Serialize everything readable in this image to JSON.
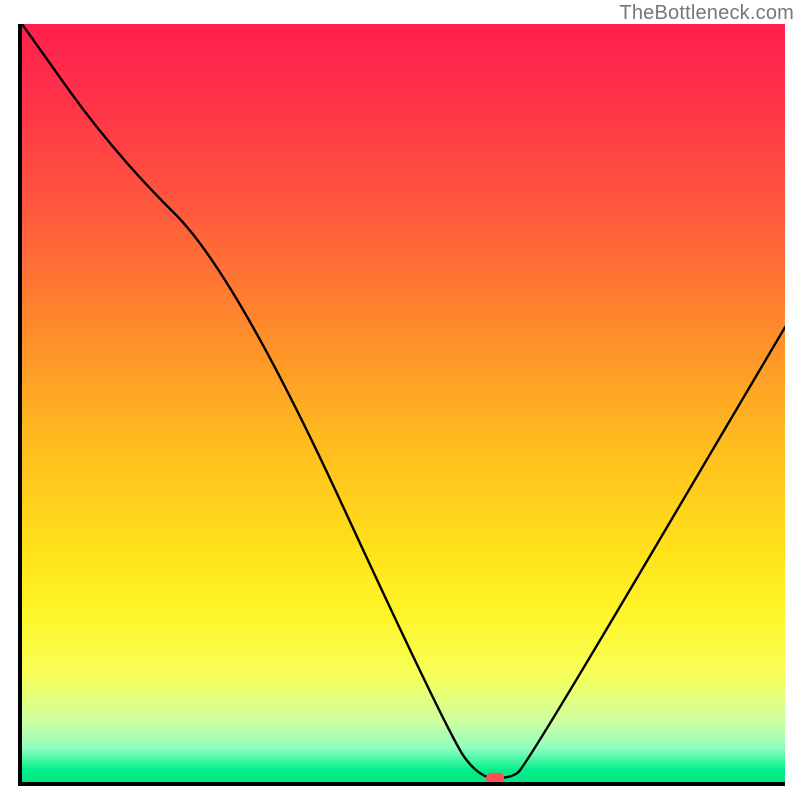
{
  "watermark": "TheBottleneck.com",
  "chart_data": {
    "type": "line",
    "title": "",
    "xlabel": "",
    "ylabel": "",
    "xlim": [
      0,
      100
    ],
    "ylim": [
      0,
      100
    ],
    "grid": false,
    "series": [
      {
        "name": "bottleneck-curve",
        "x": [
          0,
          12,
          28,
          56,
          60,
          64,
          66,
          100
        ],
        "y": [
          100,
          83,
          67,
          6,
          0.5,
          0.5,
          2,
          60
        ]
      }
    ],
    "marker": {
      "x": 62,
      "y": 0.5,
      "shape": "pill",
      "color": "#ff4e55"
    },
    "gradient_stops": [
      {
        "pos": 0.0,
        "color": "#ff1f4c"
      },
      {
        "pos": 0.1,
        "color": "#ff3249"
      },
      {
        "pos": 0.25,
        "color": "#ff5a3d"
      },
      {
        "pos": 0.4,
        "color": "#ff8a2b"
      },
      {
        "pos": 0.55,
        "color": "#ffbb1f"
      },
      {
        "pos": 0.7,
        "color": "#ffe31a"
      },
      {
        "pos": 0.78,
        "color": "#fff62a"
      },
      {
        "pos": 0.86,
        "color": "#f6ff5a"
      },
      {
        "pos": 0.92,
        "color": "#cfffa0"
      },
      {
        "pos": 0.955,
        "color": "#8fffc0"
      },
      {
        "pos": 0.985,
        "color": "#00ef8a"
      },
      {
        "pos": 1.0,
        "color": "#00e880"
      }
    ]
  }
}
